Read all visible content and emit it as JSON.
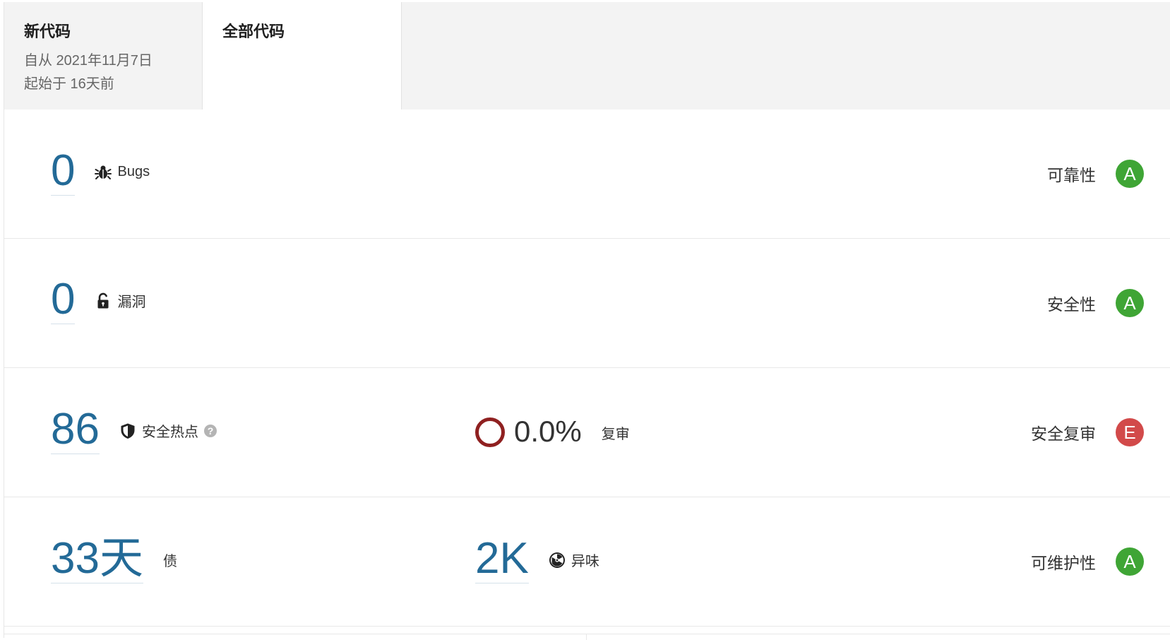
{
  "tabs": {
    "new_code": {
      "title": "新代码",
      "since": "自从 2021年11月7日",
      "started": "起始于 16天前"
    },
    "all_code": {
      "title": "全部代码"
    }
  },
  "rows": {
    "bugs": {
      "value": "0",
      "label": "Bugs",
      "rating_label": "可靠性",
      "rating": "A",
      "icon": "bug-icon"
    },
    "vulnerabilities": {
      "value": "0",
      "label": "漏洞",
      "rating_label": "安全性",
      "rating": "A",
      "icon": "unlocked-icon"
    },
    "hotspots": {
      "value": "86",
      "label": "安全热点",
      "help": "?",
      "review_value": "0.0%",
      "review_label": "复审",
      "rating_label": "安全复审",
      "rating": "E",
      "icon": "shield-icon"
    },
    "maintainability": {
      "debt_value": "33天",
      "debt_label": "债",
      "smells_value": "2K",
      "smells_label": "异味",
      "rating_label": "可维护性",
      "rating": "A",
      "icon": "radiation-icon"
    }
  },
  "colors": {
    "value_blue": "#236a97",
    "rating_a": "#3fa535",
    "rating_e": "#d24a4a",
    "review_ring": "#8f2020"
  }
}
